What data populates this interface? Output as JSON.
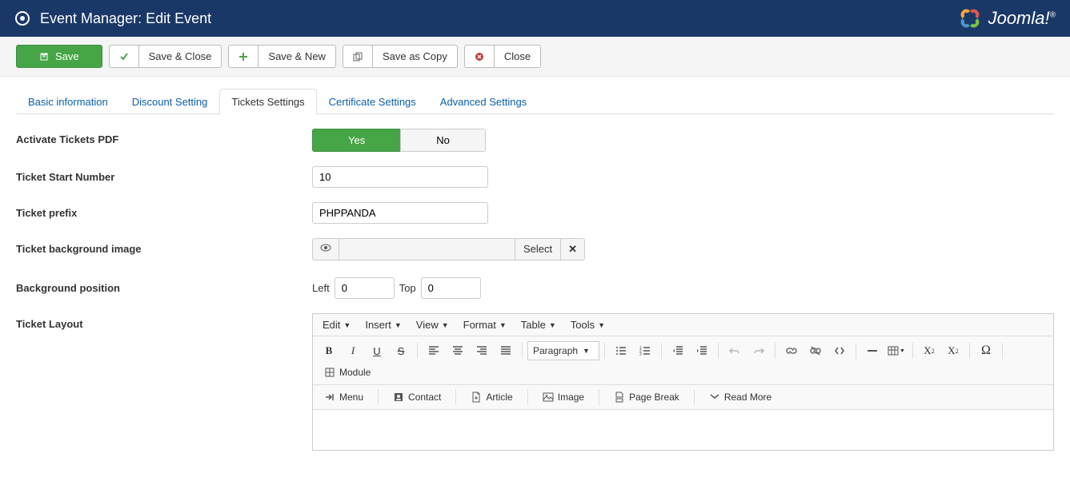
{
  "header": {
    "title": "Event Manager: Edit Event",
    "brand": "Joomla!"
  },
  "toolbar": {
    "save": "Save",
    "save_close": "Save & Close",
    "save_new": "Save & New",
    "save_copy": "Save as Copy",
    "close": "Close"
  },
  "tabs": {
    "basic": "Basic information",
    "discount": "Discount Setting",
    "tickets": "Tickets Settings",
    "certificate": "Certificate Settings",
    "advanced": "Advanced Settings"
  },
  "labels": {
    "activate_pdf": "Activate Tickets PDF",
    "start_number": "Ticket Start Number",
    "prefix": "Ticket prefix",
    "bg_image": "Ticket background image",
    "bg_position": "Background position",
    "layout": "Ticket Layout"
  },
  "values": {
    "yes": "Yes",
    "no": "No",
    "start_number": "10",
    "prefix": "PHPPANDA",
    "bg_image": "",
    "select": "Select",
    "left_label": "Left",
    "left": "0",
    "top_label": "Top",
    "top": "0"
  },
  "editor": {
    "menus": {
      "edit": "Edit",
      "insert": "Insert",
      "view": "View",
      "format": "Format",
      "table": "Table",
      "tools": "Tools"
    },
    "paragraph": "Paragraph",
    "buttons": {
      "menu": "Menu",
      "contact": "Contact",
      "article": "Article",
      "image": "Image",
      "pagebreak": "Page Break",
      "readmore": "Read More",
      "module": "Module"
    }
  }
}
